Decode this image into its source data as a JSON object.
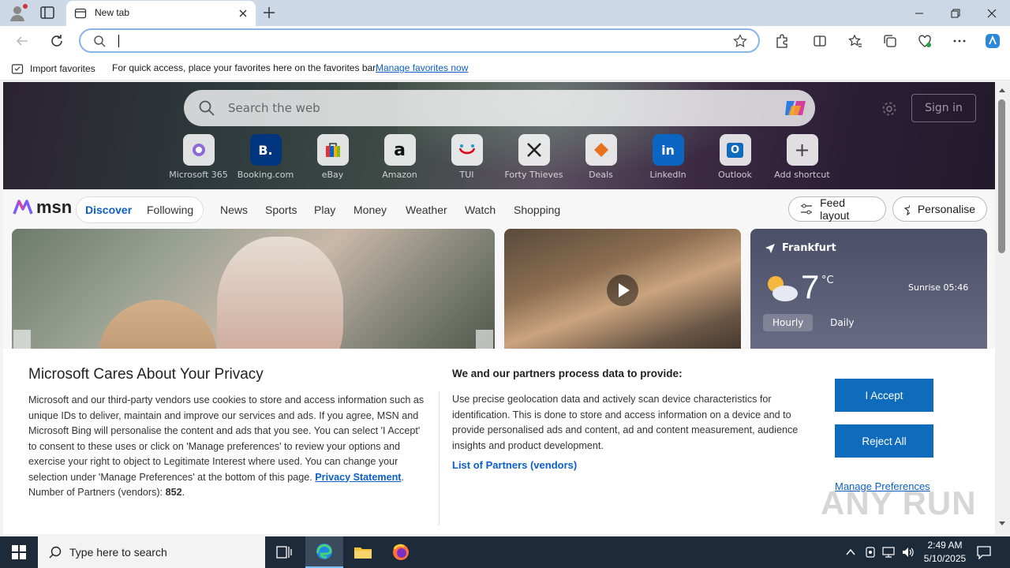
{
  "browser": {
    "tab_title": "New tab",
    "favorites_bar": {
      "import_label": "Import favorites",
      "hint": "For quick access, place your favorites here on the favorites bar.",
      "manage_link": "Manage favorites now"
    }
  },
  "newtab": {
    "search_placeholder": "Search the web",
    "sign_in": "Sign in",
    "shortcuts": [
      {
        "label": "Microsoft 365",
        "icon": "microsoft-365-icon"
      },
      {
        "label": "Booking.com",
        "icon": "booking-icon",
        "glyph": "B."
      },
      {
        "label": "eBay",
        "icon": "ebay-icon"
      },
      {
        "label": "Amazon",
        "icon": "amazon-icon",
        "glyph": "a"
      },
      {
        "label": "TUI",
        "icon": "tui-icon"
      },
      {
        "label": "Forty Thieves",
        "icon": "forty-thieves-icon"
      },
      {
        "label": "Deals",
        "icon": "deals-icon"
      },
      {
        "label": "LinkedIn",
        "icon": "linkedin-icon",
        "glyph": "in"
      },
      {
        "label": "Outlook",
        "icon": "outlook-icon",
        "glyph": "O"
      },
      {
        "label": "Add shortcut",
        "icon": "plus-icon",
        "glyph": "+"
      }
    ],
    "msn_logo": "msn",
    "nav": {
      "discover": "Discover",
      "following": "Following",
      "items": [
        "News",
        "Sports",
        "Play",
        "Money",
        "Weather",
        "Watch",
        "Shopping"
      ]
    },
    "feed_layout": "Feed layout",
    "personalise": "Personalise",
    "weather": {
      "location": "Frankfurt",
      "temp": "7",
      "unit": "°C",
      "sunrise": "Sunrise 05:46",
      "tab_hourly": "Hourly",
      "tab_daily": "Daily"
    }
  },
  "privacy": {
    "title": "Microsoft Cares About Your Privacy",
    "body": "Microsoft and our third-party vendors use cookies to store and access information such as unique IDs to deliver, maintain and improve our services and ads. If you agree, MSN and Microsoft Bing will personalise the content and ads that you see. You can select 'I Accept' to consent to these uses or click on 'Manage preferences' to review your options and exercise your right to object to Legitimate Interest where used.  You can change your selection under 'Manage Preferences' at the bottom of this page.",
    "privacy_link": "Privacy Statement",
    "partners_count_label": "Number of Partners (vendors):",
    "partners_count": "852",
    "process_title": "We and our partners process data to provide:",
    "process_body": "Use precise geolocation data and actively scan device characteristics for identification. This is done to store and access information on a device and to provide personalised ads and content, ad and content measurement, audience insights and product development.",
    "partners_link": "List of Partners (vendors)",
    "accept": "I Accept",
    "reject": "Reject All",
    "manage": "Manage Preferences"
  },
  "watermark": "ANY RUN",
  "taskbar": {
    "search_placeholder": "Type here to search",
    "time": "2:49 AM",
    "date": "5/10/2025"
  },
  "colors": {
    "accent": "#0f6cbd",
    "link": "#0c5fc7",
    "taskbar": "#1d2a3a"
  }
}
